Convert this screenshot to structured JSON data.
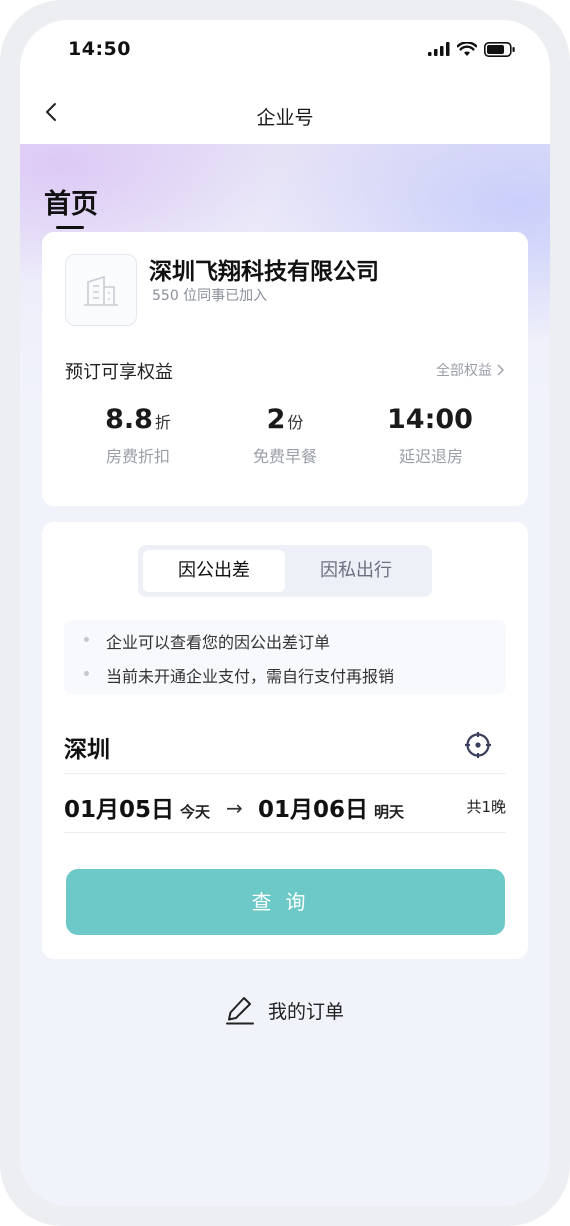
{
  "status_bar": {
    "time": "14:50"
  },
  "nav": {
    "title": "企业号",
    "back_icon": "chevron-left-icon"
  },
  "page": {
    "title": "首页"
  },
  "company": {
    "name": "深圳飞翔科技有限公司",
    "members_text": "550 位同事已加入",
    "logo_icon": "building-icon"
  },
  "benefits": {
    "title": "预订可享权益",
    "all_link": "全部权益",
    "items": [
      {
        "value": "8.8",
        "unit": "折",
        "label": "房费折扣"
      },
      {
        "value": "2",
        "unit": "份",
        "label": "免费早餐"
      },
      {
        "value": "14:00",
        "unit": "",
        "label": "延迟退房"
      }
    ]
  },
  "booking": {
    "tabs": [
      {
        "label": "因公出差",
        "active": true
      },
      {
        "label": "因私出行",
        "active": false
      }
    ],
    "notes": [
      "企业可以查看您的因公出差订单",
      "当前未开通企业支付，需自行支付再报销"
    ],
    "city": "深圳",
    "check_in": {
      "date": "01月05日",
      "tag": "今天"
    },
    "arrow": "→",
    "check_out": {
      "date": "01月06日",
      "tag": "明天"
    },
    "nights": "共1晚",
    "query_button": "查询"
  },
  "orders": {
    "label": "我的订单",
    "icon": "pencil-icon"
  },
  "colors": {
    "accent": "#6cc9c7",
    "page_bg": "#f1f3fb"
  }
}
